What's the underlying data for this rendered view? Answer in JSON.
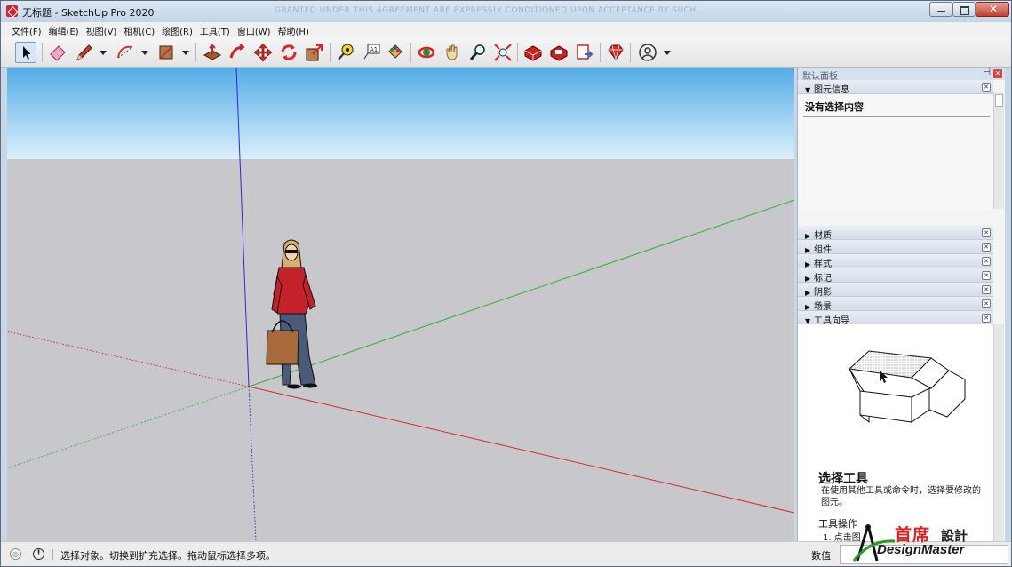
{
  "window": {
    "title": "无标题 - SketchUp Pro 2020",
    "watermark": "GRANTED UNDER THIS AGREEMENT ARE EXPRESSLY CONDITIONED UPON ACCEPTANCE BY SUCH"
  },
  "menu": [
    "文件(F)",
    "编辑(E)",
    "视图(V)",
    "相机(C)",
    "绘图(R)",
    "工具(T)",
    "窗口(W)",
    "帮助(H)"
  ],
  "toolbar": {
    "icons": [
      "select-icon",
      "eraser-icon",
      "pencil-icon",
      "arc-icon",
      "rectangle-icon",
      "push-pull-icon",
      "follow-me-icon",
      "move-icon",
      "rotate-icon",
      "scale-icon",
      "tape-measure-icon",
      "text-icon",
      "paint-bucket-icon",
      "orbit-icon",
      "pan-icon",
      "zoom-icon",
      "zoom-extents-icon",
      "warehouse-icon",
      "extension-warehouse-icon",
      "layout-send-icon",
      "extension-manager-icon",
      "account-icon"
    ]
  },
  "panel": {
    "title": "默认面板",
    "entity_info": {
      "label": "图元信息",
      "empty": "没有选择内容"
    },
    "sections": [
      "材质",
      "组件",
      "样式",
      "标记",
      "阴影",
      "场景"
    ],
    "instructor": {
      "label": "工具向导",
      "tool_title": "选择工具",
      "desc": "在使用其他工具或命令时，选择要修改的图元。",
      "ops_title": "工具操作",
      "step1": "1. 点击图"
    }
  },
  "status": {
    "message": "选择对象。切换到扩充选择。拖动鼠标选择多项。",
    "measure_label": "数值",
    "measure_value": ""
  },
  "logo": {
    "cn": "首席",
    "cn2": "設計",
    "en": "DesignMaster"
  },
  "colors": {
    "sky_top": "#5fb2ea",
    "sky_bottom": "#d8eefa",
    "ground": "#c8c8cc",
    "axis_red": "#d42a2a",
    "axis_green": "#34b634",
    "axis_blue": "#2a2ad4"
  }
}
